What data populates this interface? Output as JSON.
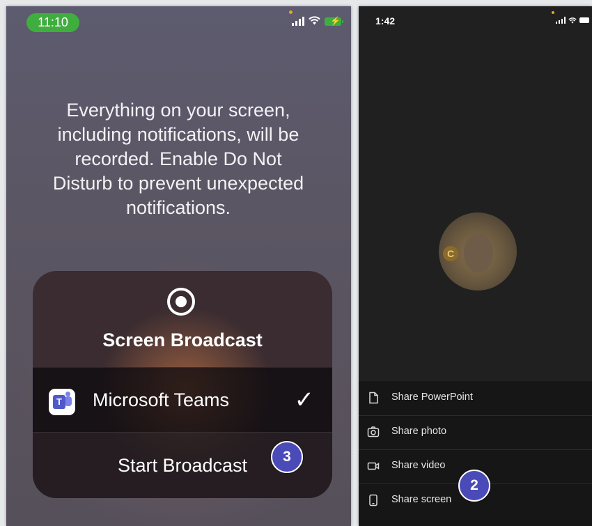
{
  "left_screen": {
    "status": {
      "time": "11:10"
    },
    "message": "Everything on your screen,\nincluding notifications, will be\nrecorded. Enable Do Not\nDisturb to prevent unexpected\nnotifications.",
    "panel": {
      "title": "Screen Broadcast",
      "selected_app": "Microsoft Teams",
      "check_glyph": "✓",
      "start_label": "Start Broadcast"
    },
    "step_badge": "3"
  },
  "right_screen": {
    "status": {
      "time": "1:42"
    },
    "avatar_badge": "C",
    "share_menu": [
      {
        "label": "Share PowerPoint",
        "icon": "document-icon"
      },
      {
        "label": "Share photo",
        "icon": "camera-icon"
      },
      {
        "label": "Share video",
        "icon": "video-icon"
      },
      {
        "label": "Share screen",
        "icon": "phone-icon"
      }
    ],
    "step_badge": "2"
  },
  "colors": {
    "time_pill": "#3fae3f",
    "badge": "#4a4ab8",
    "teams_purple": "#5059c9"
  }
}
